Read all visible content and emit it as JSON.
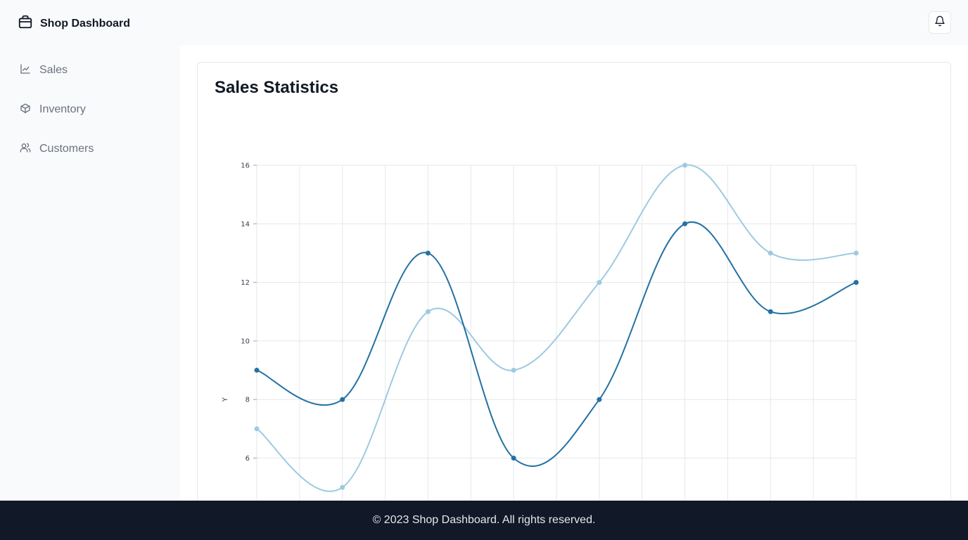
{
  "app": {
    "brand_name": "Shop Dashboard",
    "brand_icon": "store-icon",
    "notification_icon": "bell-icon"
  },
  "sidebar": {
    "items": [
      {
        "label": "Sales",
        "icon": "chart-line-icon"
      },
      {
        "label": "Inventory",
        "icon": "box-icon"
      },
      {
        "label": "Customers",
        "icon": "users-icon"
      }
    ]
  },
  "main": {
    "card_title": "Sales Statistics"
  },
  "footer": {
    "text": "© 2023 Shop Dashboard. All rights reserved."
  },
  "colors": {
    "series_dark": "#2471a3",
    "series_light": "#9ecae1",
    "grid": "#e5e7eb",
    "footer_bg": "#111827"
  },
  "chart_data": {
    "type": "line",
    "x": [
      0,
      1,
      2,
      3,
      4,
      5,
      6,
      7
    ],
    "series": [
      {
        "values": [
          9,
          8,
          13,
          6,
          8,
          14,
          11,
          12
        ],
        "color": "#2471a3"
      },
      {
        "values": [
          7,
          5,
          11,
          9,
          12,
          16,
          13,
          13
        ],
        "color": "#9ecae1"
      }
    ],
    "yticks": [
      6,
      8,
      10,
      12,
      14,
      16
    ],
    "ylabel": "Y",
    "grid": true,
    "curve": "smooth"
  }
}
